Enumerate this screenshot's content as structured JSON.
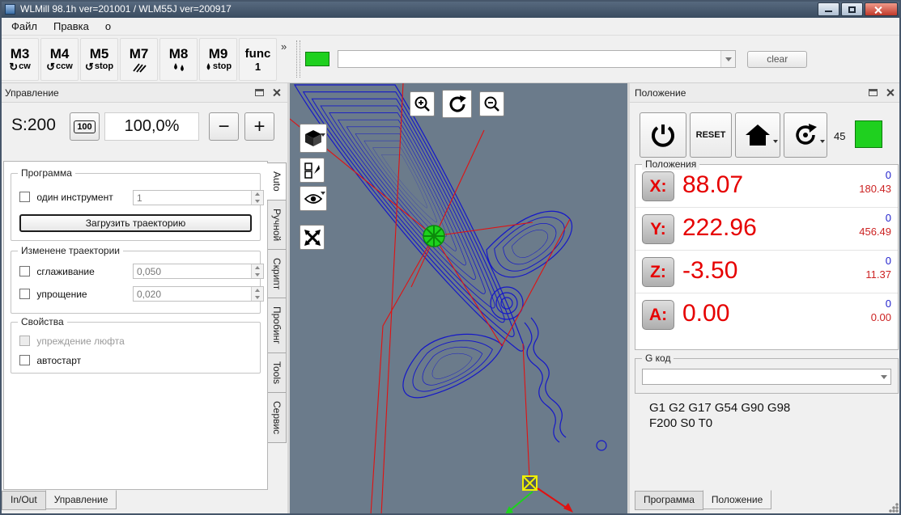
{
  "window": {
    "title": "WLMill 98.1h ver=201001 / WLM55J ver=200917"
  },
  "menu": {
    "items": [
      "Файл",
      "Правка",
      "о"
    ]
  },
  "toolbar": {
    "m_buttons": [
      {
        "label": "M3",
        "arrow": "↻",
        "sub": "cw"
      },
      {
        "label": "M4",
        "arrow": "↺",
        "sub": "ccw"
      },
      {
        "label": "M5",
        "arrow": "↺",
        "sub": "stop"
      },
      {
        "label": "M7",
        "arrow": "",
        "sub": ""
      },
      {
        "label": "M8",
        "arrow": "",
        "sub": ""
      },
      {
        "label": "M9",
        "arrow": "",
        "sub": "stop"
      },
      {
        "label": "func",
        "arrow": "",
        "sub": "1"
      }
    ],
    "overflow": "»",
    "clear_label": "clear",
    "status_color": "#1fd01f"
  },
  "left_panel": {
    "title": "Управление",
    "speed": {
      "label": "S:200",
      "preset": "100",
      "percent": "100,0%",
      "minus": "−",
      "plus": "+"
    },
    "program_group": {
      "title": "Программа",
      "single_tool_label": "один инструмент",
      "tool_value": "1",
      "load_button": "Загрузить траекторию"
    },
    "modify_group": {
      "title": "Изменене траектории",
      "smooth_label": "сглаживание",
      "smooth_value": "0,050",
      "simplify_label": "упрощение",
      "simplify_value": "0,020"
    },
    "props_group": {
      "title": "Свойства",
      "backlash_label": "упреждение люфта",
      "autostart_label": "автостарт"
    },
    "side_tabs": [
      "Auto",
      "Ручной",
      "Скрипт",
      "Пробинг",
      "Tools",
      "Сервис"
    ],
    "bottom_tabs": [
      "In/Out",
      "Управление"
    ]
  },
  "view": {
    "background": "#6b7b8b",
    "path_color": "#1518c8",
    "rapid_color": "#e11111",
    "tool_color": "#1dd21d",
    "origin_color": "#f0f000"
  },
  "right_panel": {
    "title": "Положение",
    "reset_label": "RESET",
    "spindle_angle": "45",
    "status_color": "#1fd01f",
    "axes_group_title": "Положения",
    "axes": [
      {
        "label": "X:",
        "value": "88.07",
        "zero": "0",
        "limit": "180.43"
      },
      {
        "label": "Y:",
        "value": "222.96",
        "zero": "0",
        "limit": "456.49"
      },
      {
        "label": "Z:",
        "value": "-3.50",
        "zero": "0",
        "limit": "11.37"
      },
      {
        "label": "A:",
        "value": "0.00",
        "zero": "0",
        "limit": "0.00"
      }
    ],
    "gcode_group_title": "G код",
    "gcode_lines": [
      "G1 G2 G17 G54 G90 G98",
      "F200 S0 T0"
    ],
    "bottom_tabs": [
      "Программа",
      "Положение"
    ]
  }
}
